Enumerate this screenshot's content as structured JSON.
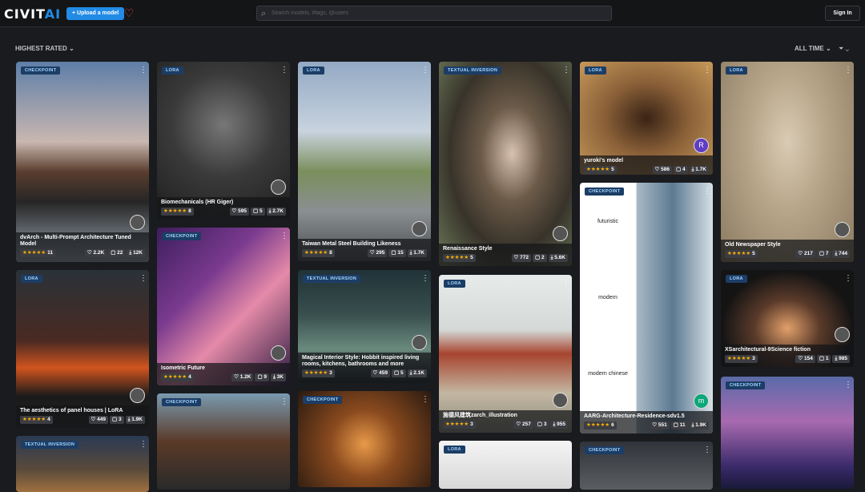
{
  "header": {
    "logo": "CIVITAI",
    "upload_label": "+ Upload a model",
    "search_placeholder": "Search models, #tags, @users",
    "signin_label": "Sign In"
  },
  "toolbar": {
    "sort": "HIGHEST RATED ⌄",
    "period": "ALL TIME ⌄",
    "filter": "⏷ ⌄"
  },
  "cards": [
    {
      "type": "CHECKPOINT",
      "title": "dvArch - Multi-Prompt Architecture Tuned Model",
      "rating_count": "11",
      "likes": "2.2K",
      "comments": "22",
      "downloads": "12K"
    },
    {
      "type": "LORA",
      "title": "Biomechanicals (HR Giger)",
      "rating_count": "8",
      "likes": "595",
      "comments": "5",
      "downloads": "2.7K"
    },
    {
      "type": "LORA",
      "title": "Taiwan Metal Steel Building Likeness",
      "rating_count": "8",
      "likes": "295",
      "comments": "15",
      "downloads": "1.7K"
    },
    {
      "type": "TEXTUAL INVERSION",
      "title": "Renaissance Style",
      "rating_count": "5",
      "likes": "772",
      "comments": "2",
      "downloads": "5.6K"
    },
    {
      "type": "LORA",
      "title": "yuroki's model",
      "rating_count": "5",
      "likes": "586",
      "comments": "4",
      "downloads": "1.7K",
      "avatar": "R"
    },
    {
      "type": "LORA",
      "title": "Old Newspaper Style",
      "rating_count": "5",
      "likes": "217",
      "comments": "7",
      "downloads": "744"
    },
    {
      "type": "CHECKPOINT",
      "title": "Isometric Future",
      "rating_count": "4",
      "likes": "1.2K",
      "comments": "9",
      "downloads": "3K"
    },
    {
      "type": "LORA",
      "title": "The aesthetics of panel houses | LoRA",
      "rating_count": "4",
      "likes": "449",
      "comments": "3",
      "downloads": "1.9K"
    },
    {
      "type": "TEXTUAL INVERSION",
      "title": "Magical Interior Style: Hobbit inspired living rooms, kitchens, bathrooms and more",
      "rating_count": "3",
      "likes": "459",
      "comments": "5",
      "downloads": "2.1K"
    },
    {
      "type": "LORA",
      "title": "施德风建筑zarch_illustration",
      "rating_count": "3",
      "likes": "257",
      "comments": "3",
      "downloads": "955"
    },
    {
      "type": "CHECKPOINT",
      "title": "AARG-Architecture-Residence-sdv1.5",
      "rating_count": "6",
      "likes": "551",
      "comments": "11",
      "downloads": "1.9K",
      "avatar": "m",
      "labels": [
        "futuristic",
        "modern",
        "modern chinese"
      ]
    },
    {
      "type": "LORA",
      "title": "XSarchitectural-9Science fiction",
      "rating_count": "3",
      "likes": "154",
      "comments": "1",
      "downloads": "985"
    },
    {
      "type": "TEXTUAL INVERSION"
    },
    {
      "type": "CHECKPOINT"
    },
    {
      "type": "CHECKPOINT"
    },
    {
      "type": "LORA"
    },
    {
      "type": "CHECKPOINT"
    },
    {
      "type": "CHECKPOINT"
    }
  ],
  "stars": "★★★★★",
  "icons": {
    "heart": "♡",
    "comment": "▢",
    "download": "⤓",
    "menu": "⋮"
  }
}
